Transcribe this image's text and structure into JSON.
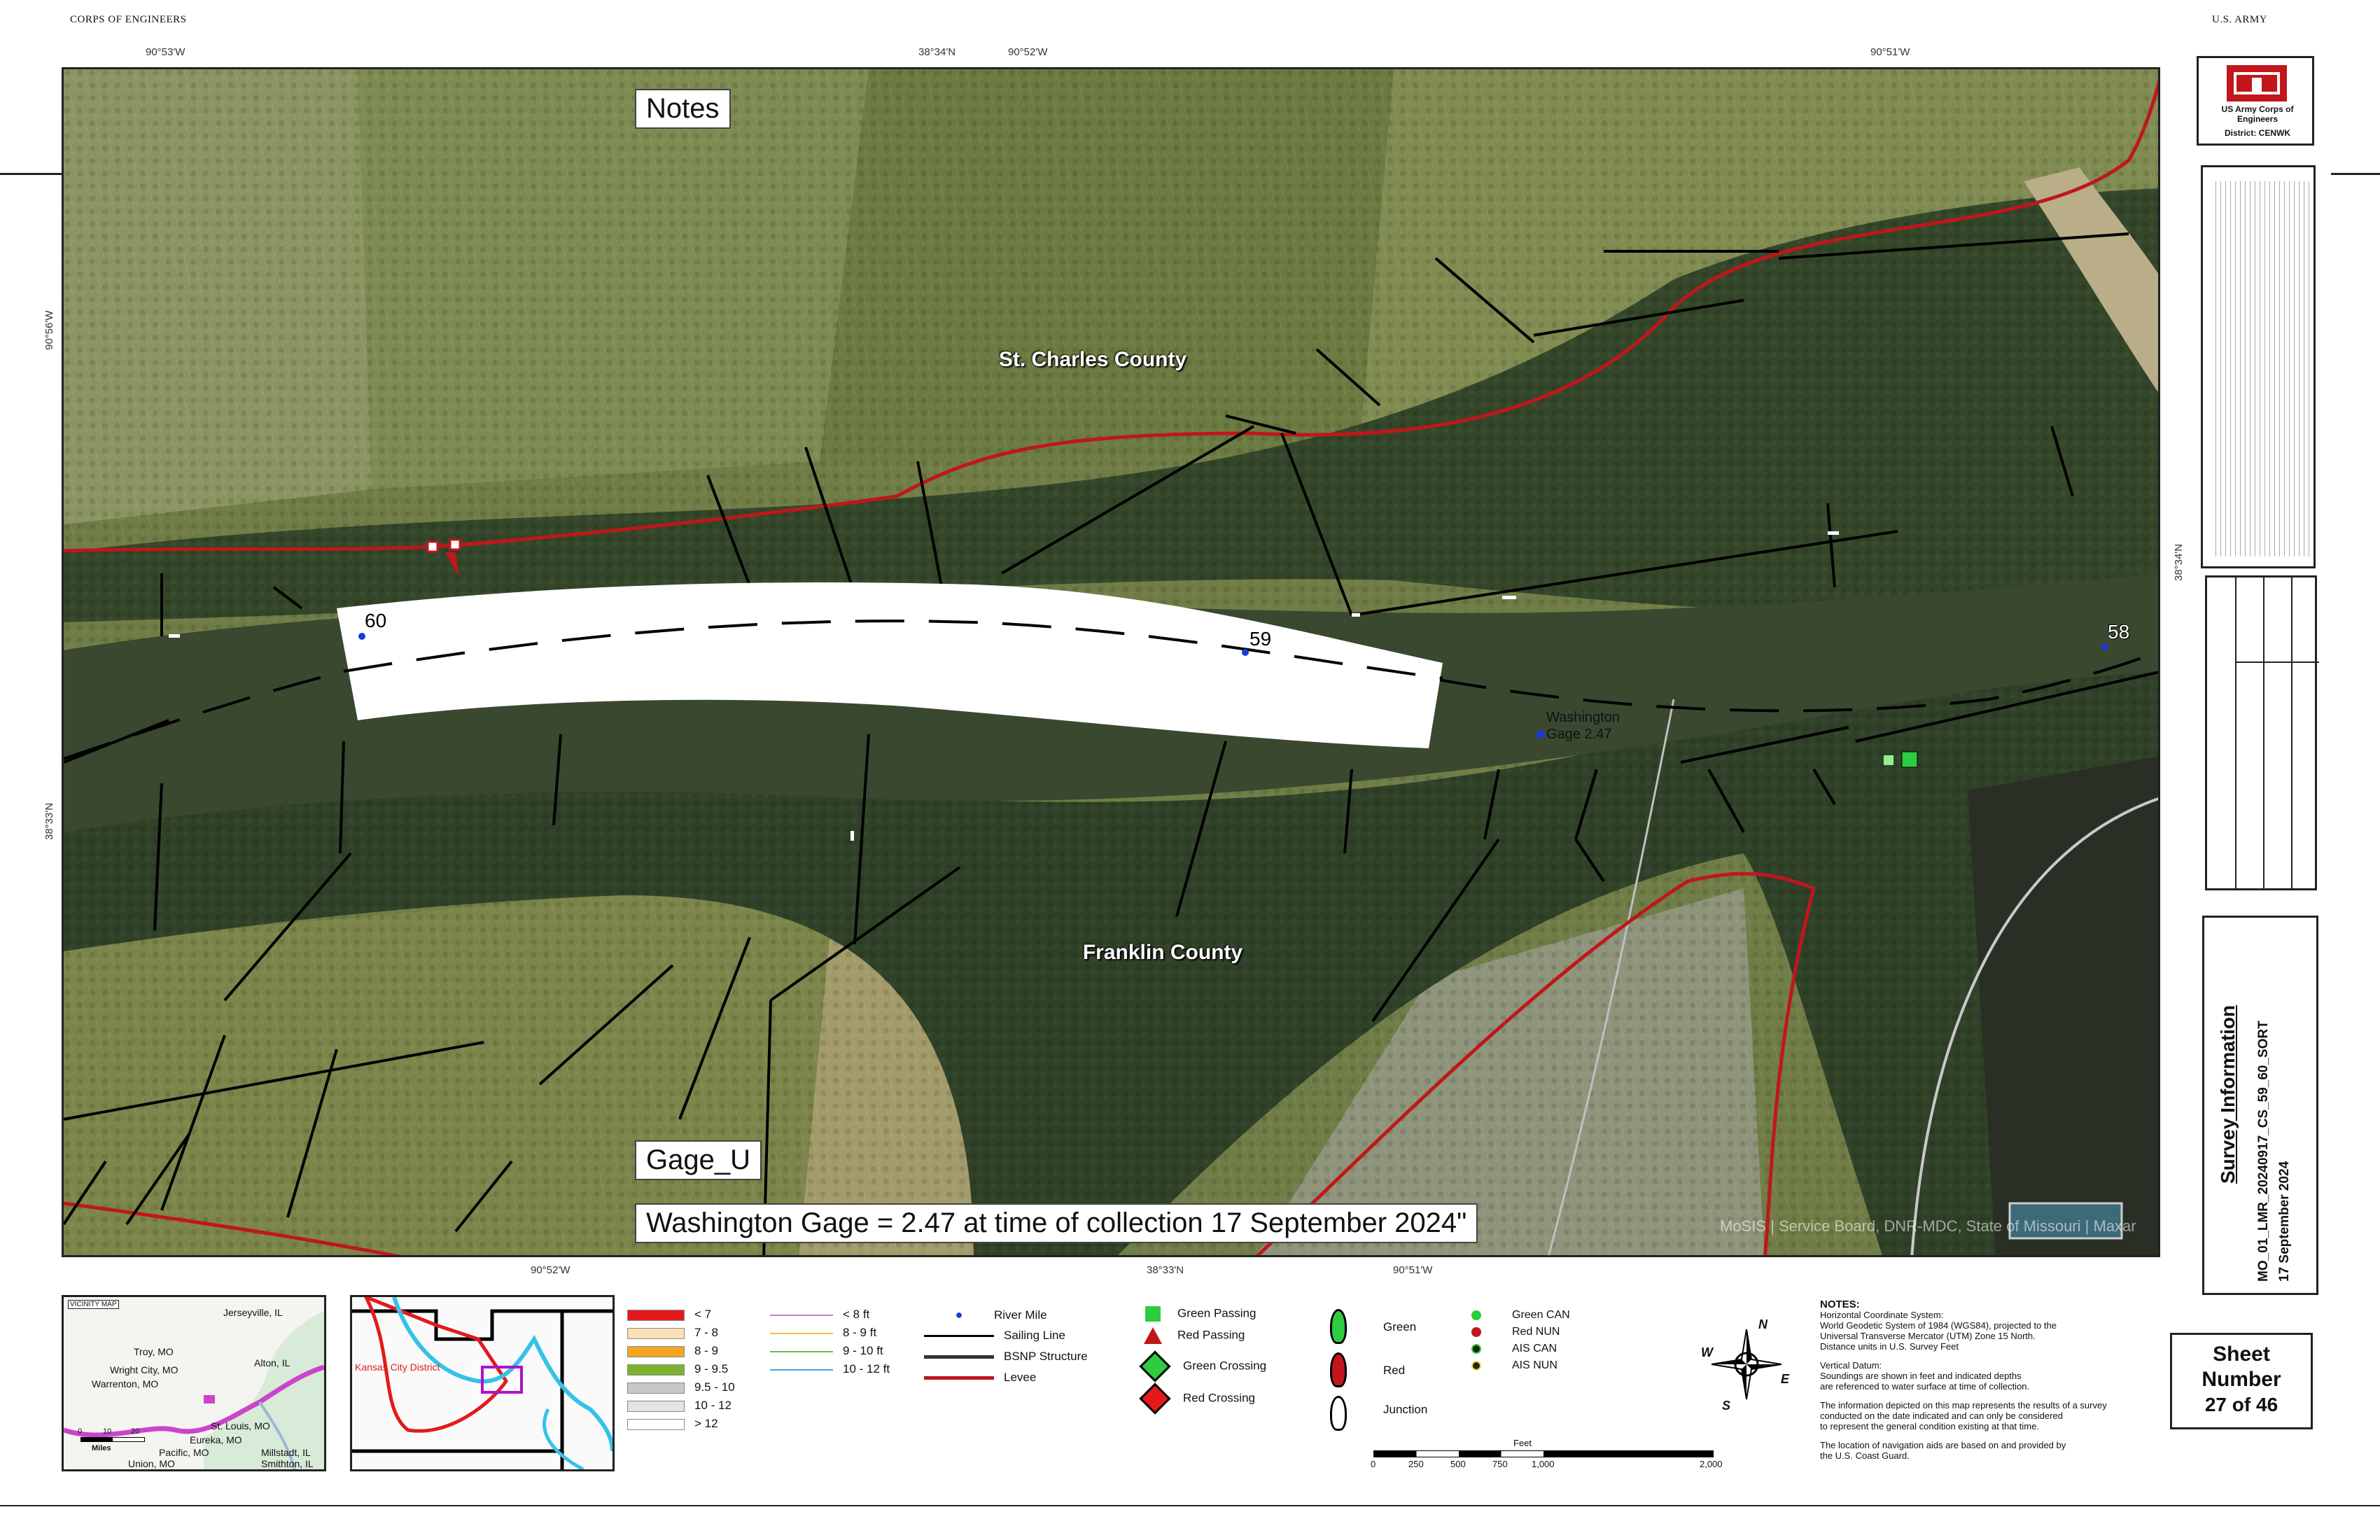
{
  "header": {
    "left": "CORPS OF ENGINEERS",
    "right": "U.S. ARMY"
  },
  "coords": {
    "top": [
      "90°53'W",
      "38°34'N",
      "90°52'W",
      "90°51'W"
    ],
    "bottom": [
      "90°52'W",
      "38°33'N",
      "90°51'W"
    ],
    "left": [
      "90°56'W",
      "38°33'N"
    ],
    "right": [
      "38°34'N"
    ]
  },
  "map": {
    "notes_box": "Notes",
    "gage_u_box": "Gage_U",
    "gage_note": "Washington Gage = 2.47 at time of collection 17 September 2024\"",
    "counties": {
      "north": "St. Charles County",
      "south": "Franklin County"
    },
    "river_miles": [
      "60",
      "59",
      "58"
    ],
    "gage_label": "Washington Gage 2.47",
    "credit": "MoSIS | Service Board, DNR-MDC, State of Missouri | Maxar"
  },
  "title_block": {
    "logo_org": "US Army Corps of Engineers",
    "logo_district": "District: CENWK",
    "survey_title": "Survey Information",
    "survey_id": "MO_01_LMR_20240917_CS_59_60_SORT",
    "survey_date": "17 September 2024",
    "sheet_label": "Sheet Number",
    "sheet_count": "27 of 46"
  },
  "vicinity": {
    "title": "VICINITY MAP",
    "places": [
      "Jerseyville, IL",
      "Troy, MO",
      "Alton, IL",
      "Wright City, MO",
      "Warrenton, MO",
      "St. Louis, MO",
      "Eureka, MO",
      "Pacific, MO",
      "Union, MO",
      "Millstadt, IL",
      "Smithton, IL"
    ],
    "scale": [
      "0",
      "10",
      "20"
    ],
    "scale_unit": "Miles"
  },
  "overview": {
    "district": "Kansas City District"
  },
  "legend": {
    "depths": [
      {
        "label": "< 7",
        "color": "#e31a1c"
      },
      {
        "label": "7 - 8",
        "color": "#fde0b8"
      },
      {
        "label": "8 - 9",
        "color": "#f5a623"
      },
      {
        "label": "9 - 9.5",
        "color": "#7ab32e"
      },
      {
        "label": "9.5 - 10",
        "color": "#c8c8c8"
      },
      {
        "label": "10 - 12",
        "color": "#e4e4e4"
      },
      {
        "label": "> 12",
        "color": "#ffffff"
      }
    ],
    "contours": [
      {
        "label": "< 8 ft",
        "color": "#c77dba"
      },
      {
        "label": "8 - 9 ft",
        "color": "#f0c040"
      },
      {
        "label": "9 - 10 ft",
        "color": "#6abf4b"
      },
      {
        "label": "10 - 12 ft",
        "color": "#4aa3df"
      }
    ],
    "features": [
      {
        "label": "River Mile",
        "kind": "dot"
      },
      {
        "label": "Sailing Line",
        "kind": "line"
      },
      {
        "label": "BSNP Structure",
        "kind": "thick"
      },
      {
        "label": "Levee",
        "kind": "red"
      }
    ],
    "crossings": [
      "Green Passing",
      "Red Passing",
      "Green Crossing",
      "Red Crossing"
    ],
    "buoys": [
      "Green",
      "Red",
      "Junction"
    ],
    "nav_aids": [
      "Green CAN",
      "Red NUN",
      "AIS CAN",
      "AIS NUN"
    ],
    "compass": [
      "N",
      "E",
      "S",
      "W"
    ]
  },
  "scale_bar": {
    "unit": "Feet",
    "ticks": [
      "0",
      "250",
      "500",
      "750",
      "1,000",
      "2,000"
    ]
  },
  "notes": {
    "title": "NOTES:",
    "lines": [
      "Horizontal Coordinate System:",
      "World Geodetic System of 1984 (WGS84), projected to the",
      "Universal Transverse Mercator (UTM) Zone 15 North.",
      "Distance units in U.S. Survey Feet",
      "",
      "Vertical Datum:",
      "Soundings are shown in feet and indicated depths",
      "are referenced to water surface at time of collection.",
      "",
      "The information depicted on this map represents the results of a survey",
      "conducted on the date indicated and can only be considered",
      "to represent the general condition existing at that time.",
      "",
      "The location of navigation aids are based on and provided by",
      "the U.S. Coast Guard."
    ]
  },
  "colors": {
    "levee": "#c0161c",
    "survey": "#ffffff",
    "river": "#3b4a2c",
    "field": "#6b7a3e",
    "forest": "#2c3b22"
  }
}
